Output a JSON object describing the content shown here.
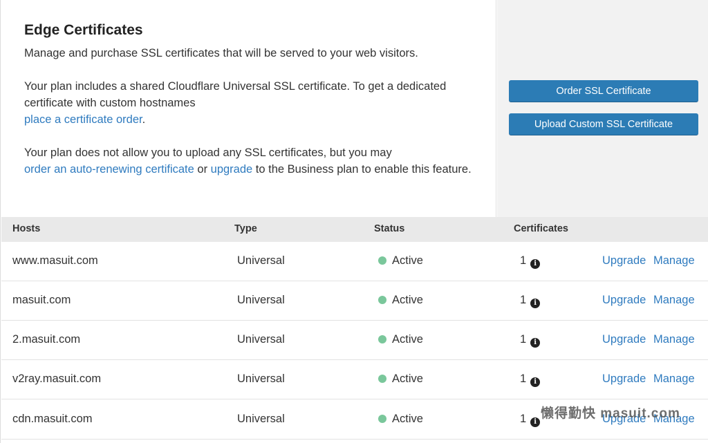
{
  "header": {
    "title": "Edge Certificates",
    "description": "Manage and purchase SSL certificates that will be served to your web visitors.",
    "plan_text": "Your plan includes a shared Cloudflare Universal SSL certificate. To get a dedicated certificate with custom hostnames",
    "plan_link": "place a certificate order",
    "plan_suffix": ".",
    "upload_text": "Your plan does not allow you to upload any SSL certificates, but you may",
    "upload_link1": "order an auto-renewing certificate",
    "upload_or": " or ",
    "upload_link2": "upgrade",
    "upload_suffix": " to the Business plan to enable this feature."
  },
  "actions": {
    "order_label": "Order SSL Certificate",
    "upload_label": "Upload Custom SSL Certificate"
  },
  "table": {
    "columns": [
      "Hosts",
      "Type",
      "Status",
      "Certificates"
    ],
    "rows": [
      {
        "host": "www.masuit.com",
        "type": "Universal",
        "status": "Active",
        "certs": "1",
        "upgrade": "Upgrade",
        "manage": "Manage"
      },
      {
        "host": "masuit.com",
        "type": "Universal",
        "status": "Active",
        "certs": "1",
        "upgrade": "Upgrade",
        "manage": "Manage"
      },
      {
        "host": "2.masuit.com",
        "type": "Universal",
        "status": "Active",
        "certs": "1",
        "upgrade": "Upgrade",
        "manage": "Manage"
      },
      {
        "host": "v2ray.masuit.com",
        "type": "Universal",
        "status": "Active",
        "certs": "1",
        "upgrade": "Upgrade",
        "manage": "Manage"
      },
      {
        "host": "cdn.masuit.com",
        "type": "Universal",
        "status": "Active",
        "certs": "1",
        "upgrade": "Upgrade",
        "manage": "Manage"
      }
    ]
  },
  "watermark": "懒得勤快 masuit.com",
  "colors": {
    "accent": "#2c7cb5",
    "link": "#2f7bbf",
    "status_active": "#7ac79b"
  },
  "icons": {
    "info": "info-icon"
  }
}
